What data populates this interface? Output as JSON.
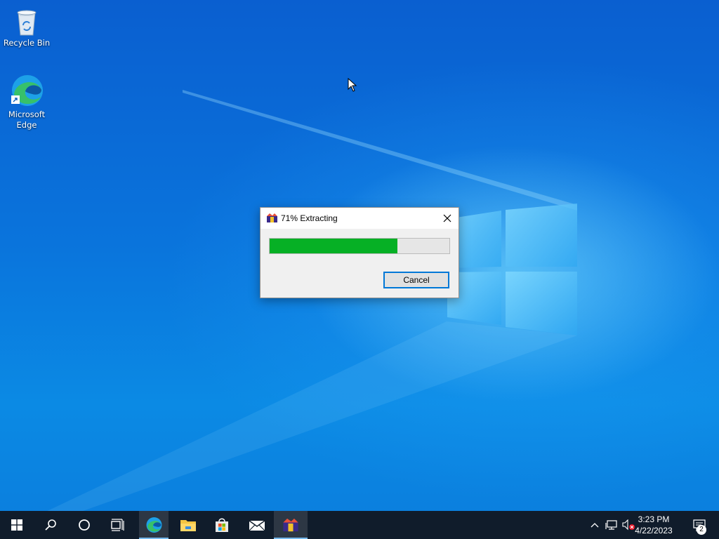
{
  "desktop": {
    "icons": [
      {
        "label": "Recycle Bin",
        "icon": "recycle-bin-icon"
      },
      {
        "label": "Microsoft\nEdge",
        "icon": "edge-icon"
      }
    ]
  },
  "dialog": {
    "title": "71% Extracting",
    "progress_percent": 71,
    "cancel_label": "Cancel",
    "progress_color": "#06b025"
  },
  "taskbar": {
    "pinned": [
      "start-icon",
      "search-icon",
      "cortana-icon",
      "task-view-icon",
      "edge-icon",
      "file-explorer-icon",
      "store-icon",
      "mail-icon",
      "extractor-app-icon"
    ],
    "clock": {
      "time": "3:23 PM",
      "date": "4/22/2023"
    },
    "notification_count": "2"
  },
  "colors": {
    "accent": "#0078d7",
    "taskbar": "#101c2b"
  }
}
